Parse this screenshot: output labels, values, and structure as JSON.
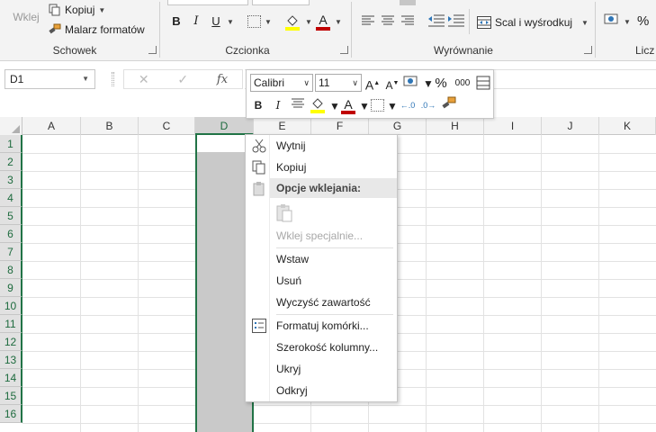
{
  "ribbon": {
    "paste_label": "Wklej",
    "copy_label": "Kopiuj",
    "format_painter_label": "Malarz formatów",
    "groups": {
      "clipboard": "Schowek",
      "font": "Czcionka",
      "alignment": "Wyrównanie",
      "number": "Licz"
    },
    "merge_label": "Scal i wyśrodkuj",
    "bold": "B",
    "italic": "I",
    "underline": "U",
    "font_color_letter": "A",
    "percent": "%"
  },
  "formula_bar": {
    "name_box": "D1",
    "fx": "fx"
  },
  "mini_toolbar": {
    "font_name": "Calibri",
    "font_size": "11",
    "grow": "A",
    "shrink": "A",
    "percent": "%",
    "thousands": "000",
    "bold": "B",
    "italic": "I",
    "font_color_letter": "A"
  },
  "grid": {
    "columns": [
      "A",
      "B",
      "C",
      "D",
      "E",
      "F",
      "G",
      "H",
      "I",
      "J",
      "K"
    ],
    "rows": [
      "1",
      "2",
      "3",
      "4",
      "5",
      "6",
      "7",
      "8",
      "9",
      "10",
      "11",
      "12",
      "13",
      "14",
      "15",
      "16"
    ],
    "selected_column": "D"
  },
  "context_menu": {
    "cut": "Wytnij",
    "copy": "Kopiuj",
    "paste_options_header": "Opcje wklejania:",
    "paste_special": "Wklej specjalnie...",
    "insert": "Wstaw",
    "delete": "Usuń",
    "clear_contents": "Wyczyść zawartość",
    "format_cells": "Formatuj komórki...",
    "column_width": "Szerokość kolumny...",
    "hide": "Ukryj",
    "unhide": "Odkryj"
  },
  "colors": {
    "excel_green": "#217346",
    "font_color_red": "#c00000",
    "highlight_yellow": "#ffff00"
  }
}
